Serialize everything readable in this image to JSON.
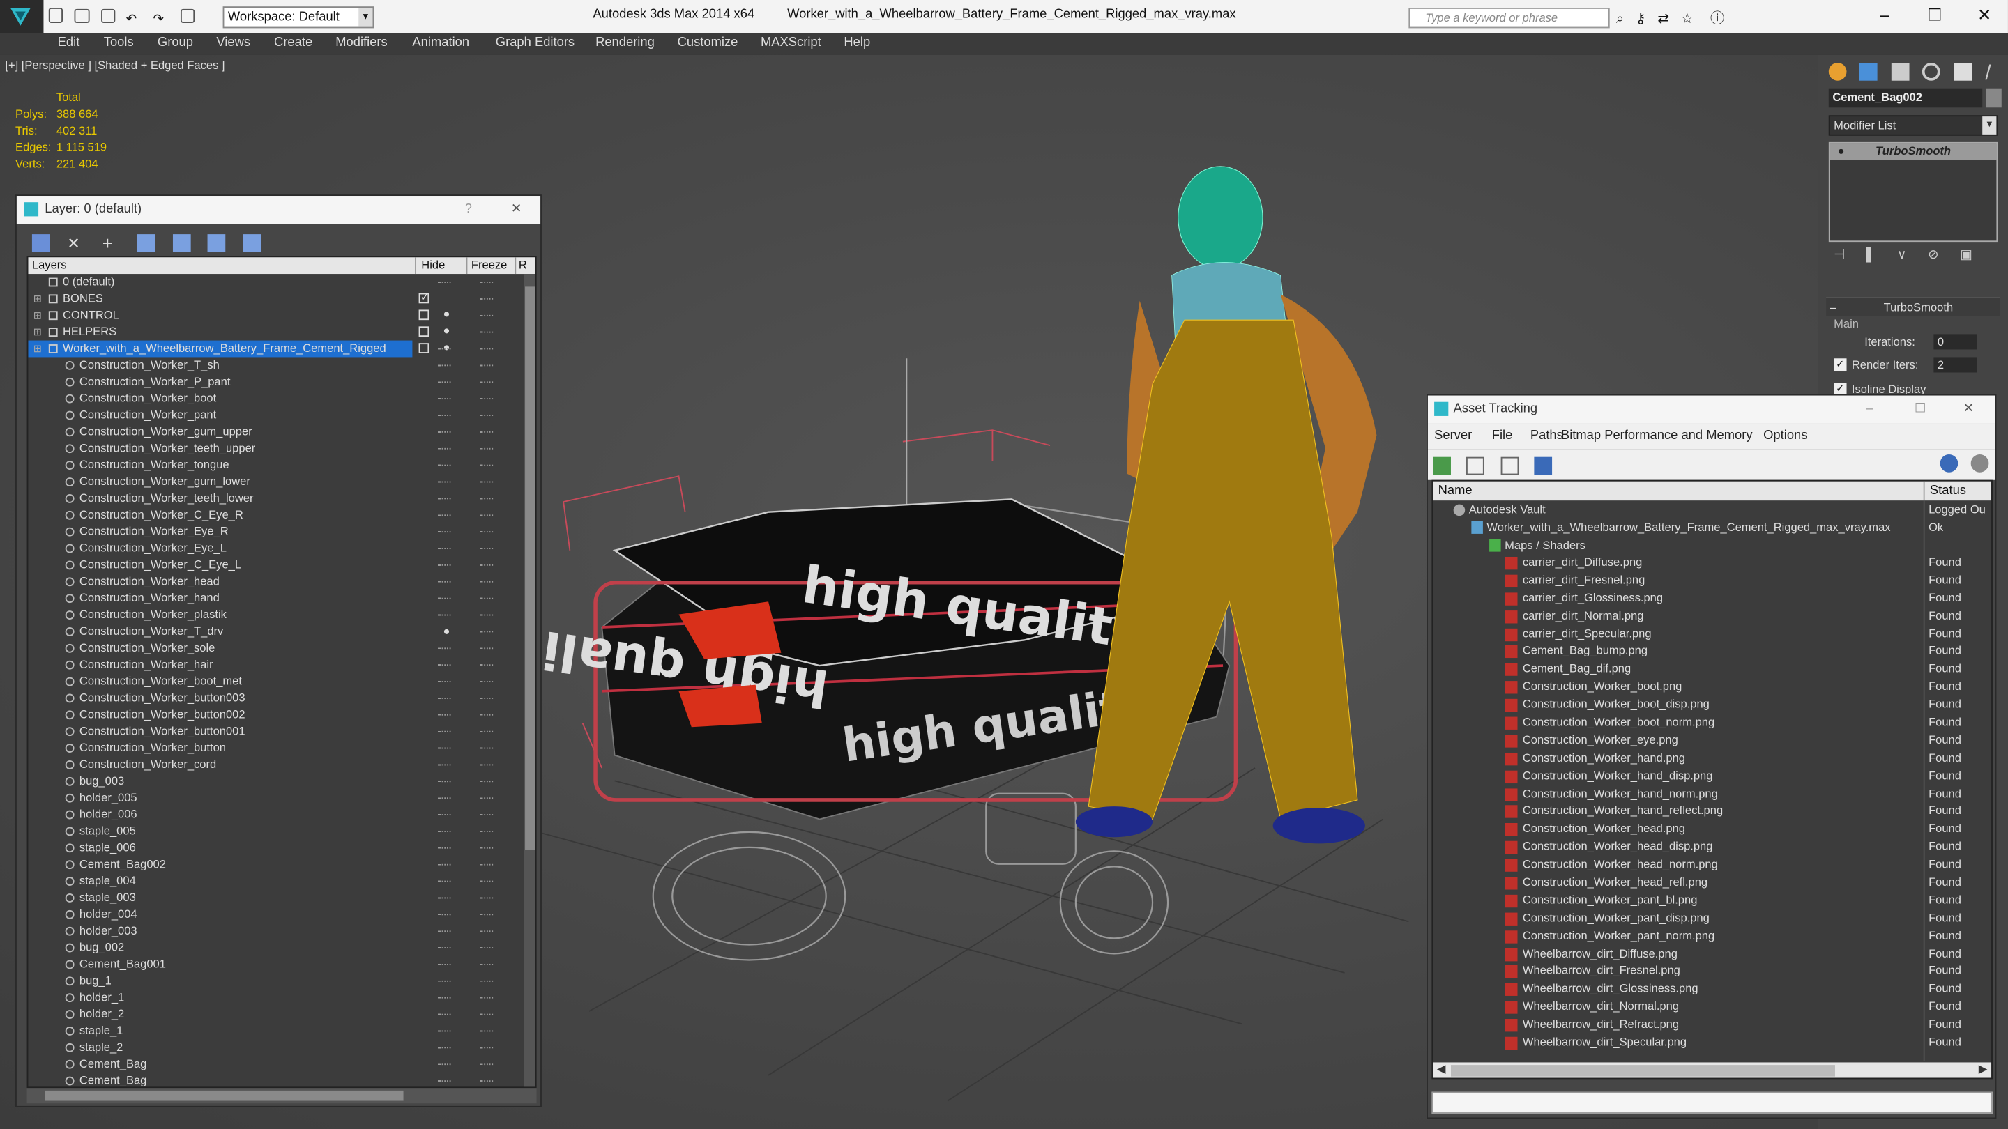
{
  "app": {
    "title": "Autodesk 3ds Max 2014 x64",
    "file": "Worker_with_a_Wheelbarrow_Battery_Frame_Cement_Rigged_max_vray.max",
    "workspace": "Workspace: Default",
    "search_placeholder": "Type a keyword or phrase"
  },
  "menu": [
    "Edit",
    "Tools",
    "Group",
    "Views",
    "Create",
    "Modifiers",
    "Animation",
    "Graph Editors",
    "Rendering",
    "Customize",
    "MAXScript",
    "Help"
  ],
  "viewport": {
    "label": "[+] [Perspective ] [Shaded + Edged Faces ]"
  },
  "stats": {
    "header": "Total",
    "rows": [
      {
        "label": "Polys:",
        "value": "388 664"
      },
      {
        "label": "Tris:",
        "value": "402 311"
      },
      {
        "label": "Edges:",
        "value": "1 115 519"
      },
      {
        "label": "Verts:",
        "value": "221 404"
      }
    ]
  },
  "layer": {
    "title": "Layer: 0 (default)",
    "help": "?",
    "cols": {
      "name": "Layers",
      "hide": "Hide",
      "freeze": "Freeze",
      "r": "R"
    },
    "top": [
      {
        "n": "0 (default)",
        "s": "check"
      },
      {
        "n": "BONES",
        "s": "bulb"
      },
      {
        "n": "CONTROL",
        "s": "bulb"
      },
      {
        "n": "HELPERS",
        "s": "bulb"
      },
      {
        "n": "Worker_with_a_Wheelbarrow_Battery_Frame_Cement_Rigged",
        "s": "box"
      }
    ],
    "objects": [
      "Construction_Worker_T_sh",
      "Construction_Worker_P_pant",
      "Construction_Worker_boot",
      "Construction_Worker_pant",
      "Construction_Worker_gum_upper",
      "Construction_Worker_teeth_upper",
      "Construction_Worker_tongue",
      "Construction_Worker_gum_lower",
      "Construction_Worker_teeth_lower",
      "Construction_Worker_C_Eye_R",
      "Construction_Worker_Eye_R",
      "Construction_Worker_Eye_L",
      "Construction_Worker_C_Eye_L",
      "Construction_Worker_head",
      "Construction_Worker_hand",
      "Construction_Worker_plastik",
      "Construction_Worker_T_drv",
      "Construction_Worker_sole",
      "Construction_Worker_hair",
      "Construction_Worker_boot_met",
      "Construction_Worker_button003",
      "Construction_Worker_button002",
      "Construction_Worker_button001",
      "Construction_Worker_button",
      "Construction_Worker_cord",
      "bug_003",
      "holder_005",
      "holder_006",
      "staple_005",
      "staple_006",
      "Cement_Bag002",
      "staple_004",
      "staple_003",
      "holder_004",
      "holder_003",
      "bug_002",
      "Cement_Bag001",
      "bug_1",
      "holder_1",
      "holder_2",
      "staple_1",
      "staple_2",
      "Cement_Bag",
      "Cement_Bag"
    ]
  },
  "command": {
    "object": "Cement_Bag002",
    "modlist": "Modifier List",
    "stack_item": "TurboSmooth",
    "rollout": "TurboSmooth",
    "main": "Main",
    "iterations_label": "Iterations:",
    "iterations": "0",
    "render_iters_label": "Render Iters:",
    "render_iters": "2",
    "isoline": "Isoline Display"
  },
  "asset": {
    "title": "Asset Tracking",
    "menu": [
      "Server",
      "File",
      "Paths",
      "Bitmap Performance and Memory",
      "Options"
    ],
    "cols": {
      "name": "Name",
      "status": "Status"
    },
    "vault": {
      "n": "Autodesk Vault",
      "s": "Logged Ou"
    },
    "file": {
      "n": "Worker_with_a_Wheelbarrow_Battery_Frame_Cement_Rigged_max_vray.max",
      "s": "Ok"
    },
    "maps": "Maps / Shaders",
    "items": [
      "carrier_dirt_Diffuse.png",
      "carrier_dirt_Fresnel.png",
      "carrier_dirt_Glossiness.png",
      "carrier_dirt_Normal.png",
      "carrier_dirt_Specular.png",
      "Cement_Bag_bump.png",
      "Cement_Bag_dif.png",
      "Construction_Worker_boot.png",
      "Construction_Worker_boot_disp.png",
      "Construction_Worker_boot_norm.png",
      "Construction_Worker_eye.png",
      "Construction_Worker_hand.png",
      "Construction_Worker_hand_disp.png",
      "Construction_Worker_hand_norm.png",
      "Construction_Worker_hand_reflect.png",
      "Construction_Worker_head.png",
      "Construction_Worker_head_disp.png",
      "Construction_Worker_head_norm.png",
      "Construction_Worker_head_refl.png",
      "Construction_Worker_pant_bl.png",
      "Construction_Worker_pant_disp.png",
      "Construction_Worker_pant_norm.png",
      "Wheelbarrow_dirt_Diffuse.png",
      "Wheelbarrow_dirt_Fresnel.png",
      "Wheelbarrow_dirt_Glossiness.png",
      "Wheelbarrow_dirt_Normal.png",
      "Wheelbarrow_dirt_Refract.png",
      "Wheelbarrow_dirt_Specular.png"
    ],
    "found": "Found"
  },
  "bag_text": "high quality"
}
